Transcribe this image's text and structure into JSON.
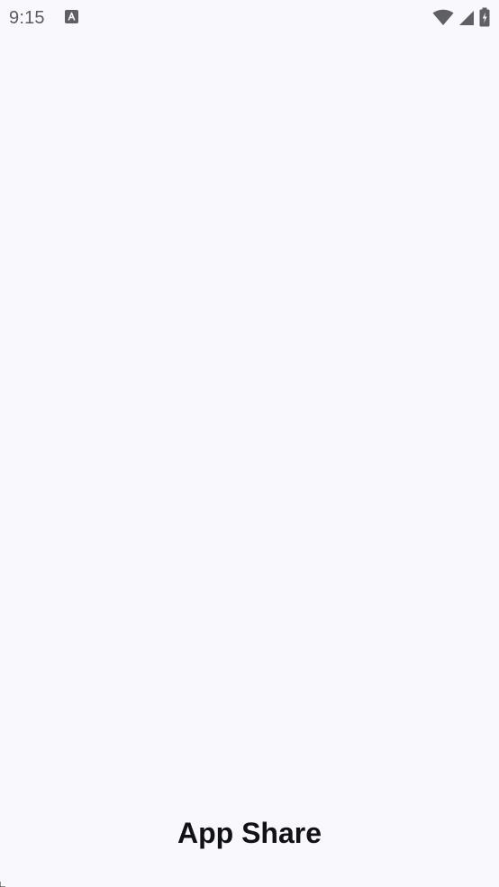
{
  "status_bar": {
    "time": "9:15",
    "notification_icon": "autofill-a-icon",
    "wifi_icon": "wifi-icon",
    "signal_icon": "cell-signal-icon",
    "battery_icon": "battery-charging-icon"
  },
  "app": {
    "title": "App Share"
  },
  "colors": {
    "background": "#f9f8fd",
    "status_icons": "#5f5f66",
    "title": "#111217"
  }
}
